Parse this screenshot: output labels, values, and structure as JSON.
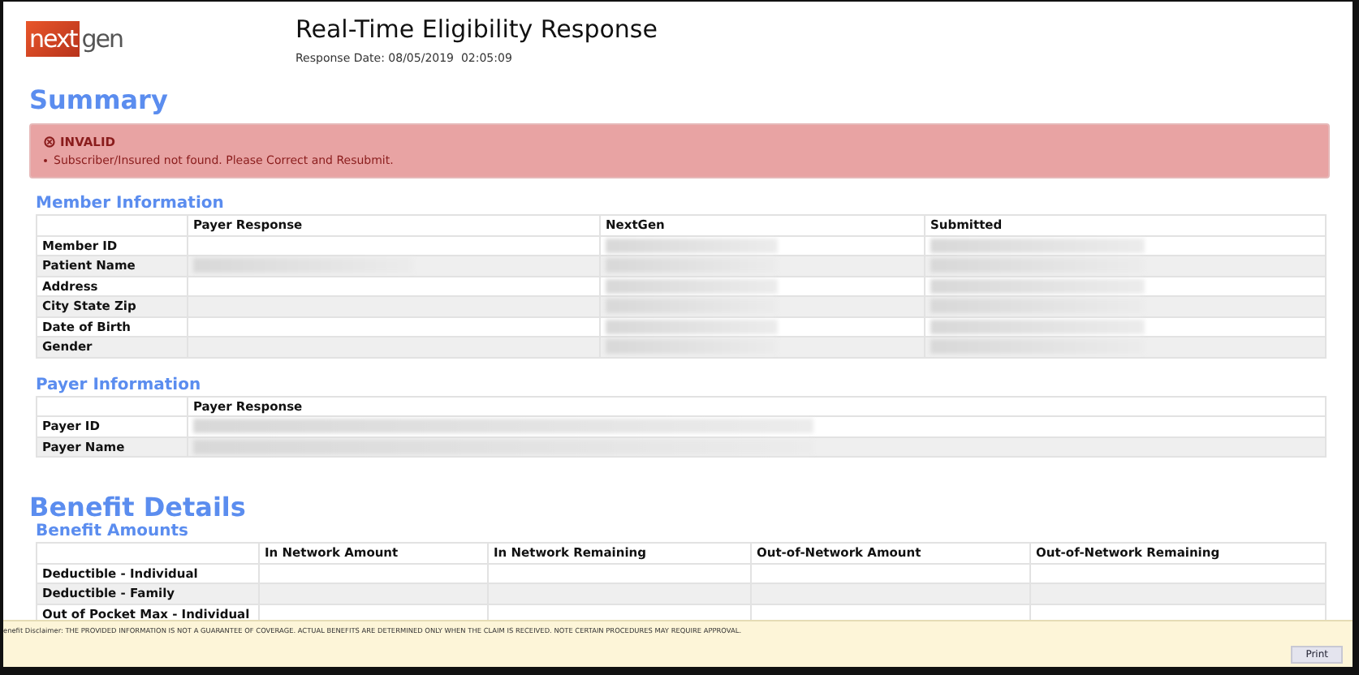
{
  "header": {
    "logo": {
      "first": "next",
      "second": "gen"
    },
    "title": "Real-Time Eligibility Response",
    "response_date": "Response Date: 08/05/2019  02:05:09"
  },
  "summary": {
    "heading": "Summary",
    "alert": {
      "status": "INVALID",
      "messages": [
        "Subscriber/Insured not found. Please Correct and Resubmit."
      ]
    }
  },
  "member_information": {
    "heading": "Member Information",
    "columns": [
      "Payer Response",
      "NextGen",
      "Submitted"
    ],
    "rows": [
      {
        "label": "Member ID",
        "cells": [
          {
            "redacted": false
          },
          {
            "redacted": true
          },
          {
            "redacted": true
          }
        ]
      },
      {
        "label": "Patient Name",
        "cells": [
          {
            "redacted": true
          },
          {
            "redacted": true
          },
          {
            "redacted": true
          }
        ]
      },
      {
        "label": "Address",
        "cells": [
          {
            "redacted": false
          },
          {
            "redacted": true
          },
          {
            "redacted": true
          }
        ]
      },
      {
        "label": "City State Zip",
        "cells": [
          {
            "redacted": false
          },
          {
            "redacted": true
          },
          {
            "redacted": true
          }
        ]
      },
      {
        "label": "Date of Birth",
        "cells": [
          {
            "redacted": false
          },
          {
            "redacted": true
          },
          {
            "redacted": true
          }
        ]
      },
      {
        "label": "Gender",
        "cells": [
          {
            "redacted": false
          },
          {
            "redacted": true
          },
          {
            "redacted": true
          }
        ]
      }
    ]
  },
  "payer_information": {
    "heading": "Payer Information",
    "columns": [
      "Payer Response"
    ],
    "rows": [
      {
        "label": "Payer ID",
        "cells": [
          {
            "redacted": true
          }
        ]
      },
      {
        "label": "Payer Name",
        "cells": [
          {
            "redacted": true
          }
        ]
      }
    ]
  },
  "benefit_details": {
    "heading": "Benefit Details",
    "subheading": "Benefit Amounts",
    "columns": [
      "In Network Amount",
      "In Network Remaining",
      "Out-of-Network Amount",
      "Out-of-Network Remaining"
    ],
    "rows": [
      {
        "label": "Deductible - Individual",
        "cells": [
          {
            "redacted": false
          },
          {
            "redacted": false
          },
          {
            "redacted": false
          },
          {
            "redacted": false
          }
        ]
      },
      {
        "label": "Deductible - Family",
        "cells": [
          {
            "redacted": false
          },
          {
            "redacted": false
          },
          {
            "redacted": false
          },
          {
            "redacted": false
          }
        ]
      },
      {
        "label": "Out of Pocket Max - Individual",
        "cells": [
          {
            "redacted": false
          },
          {
            "redacted": false
          },
          {
            "redacted": false
          },
          {
            "redacted": false
          }
        ]
      }
    ]
  },
  "footer": {
    "disclaimer": "enefit Disclaimer: THE PROVIDED INFORMATION IS NOT A GUARANTEE OF COVERAGE.  ACTUAL BENEFITS ARE DETERMINED ONLY WHEN THE CLAIM IS RECEIVED. NOTE CERTAIN PROCEDURES MAY REQUIRE APPROVAL.",
    "print_button": "Print"
  }
}
